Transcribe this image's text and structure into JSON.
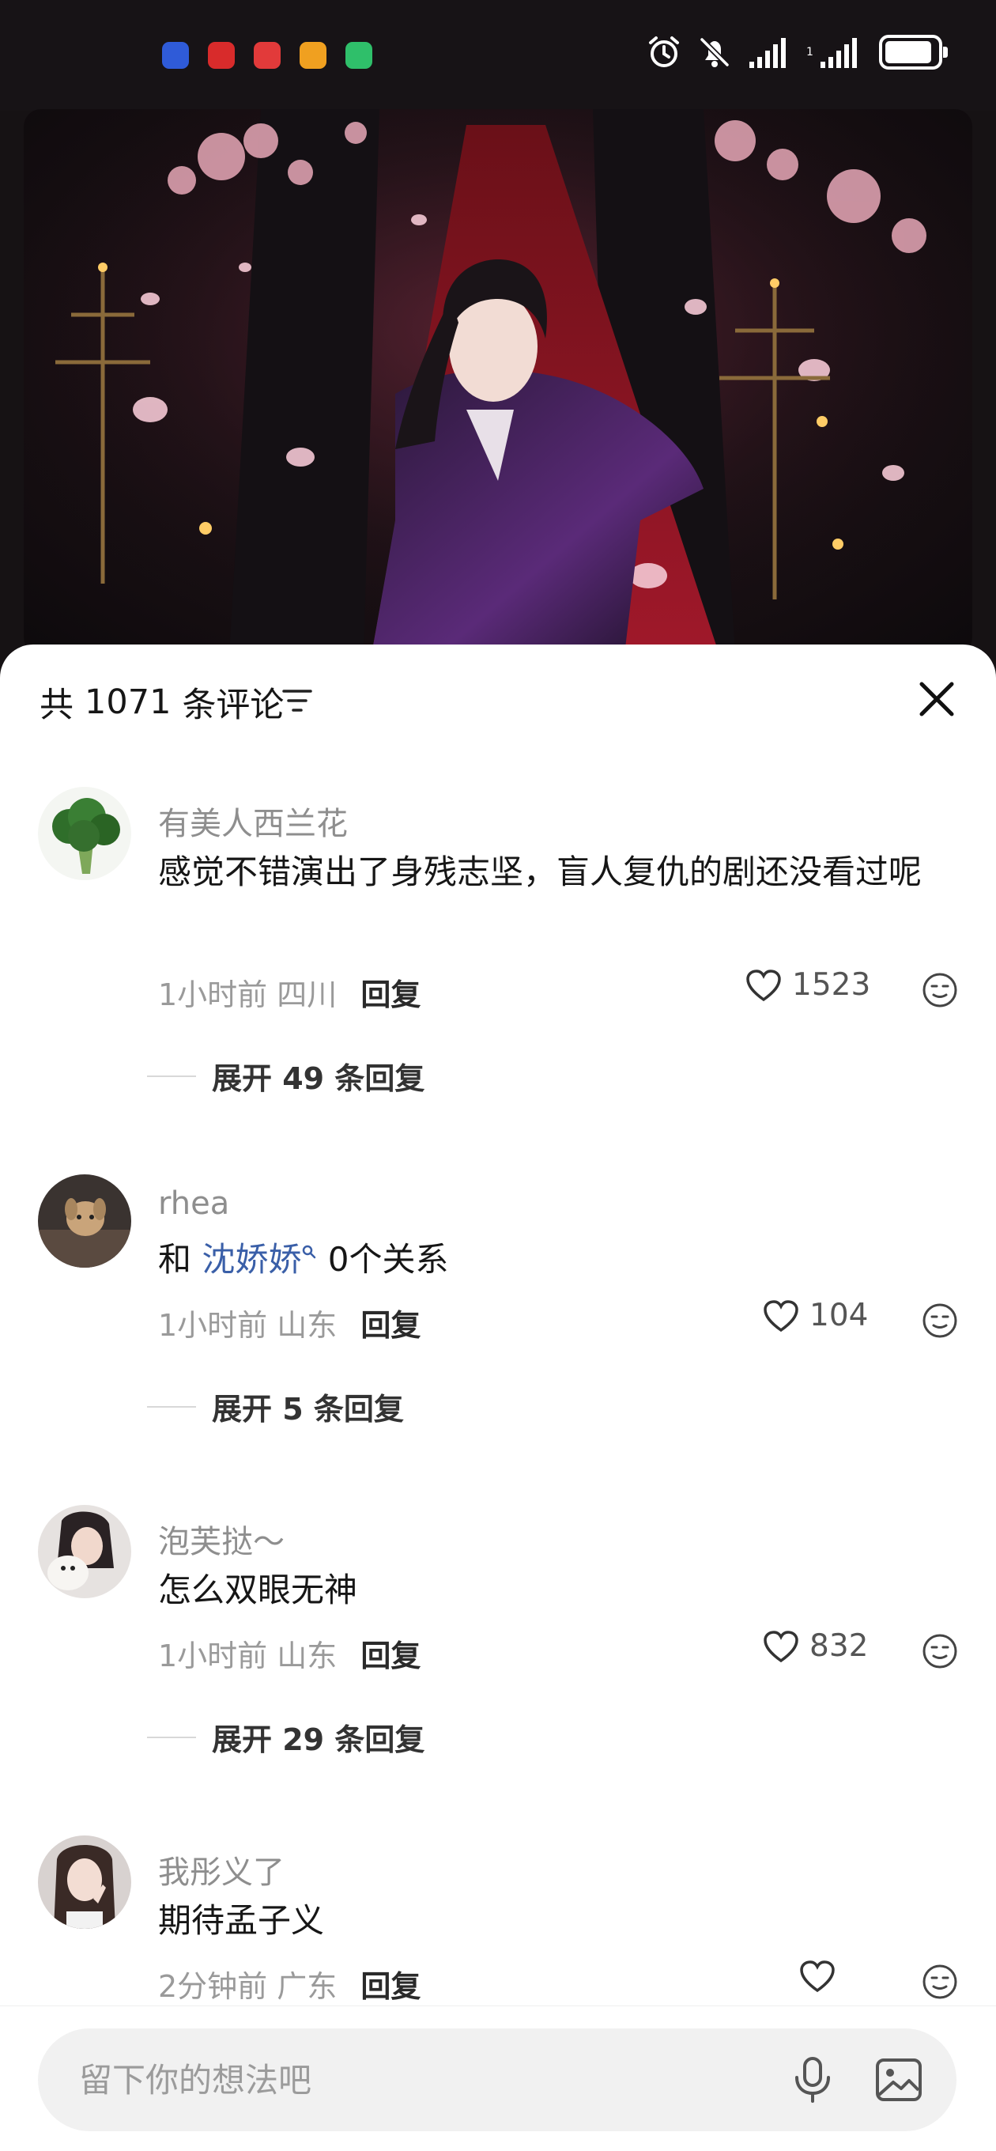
{
  "status_bar": {
    "notification_colors": [
      "#2f5bd8",
      "#d82b2b",
      "#e23a3a",
      "#f0a020",
      "#2fbf6a"
    ],
    "icons": [
      "alarm-icon",
      "mute-icon",
      "signal-icon",
      "signal-4g-icon",
      "battery-icon"
    ],
    "battery_level": 0.9
  },
  "header": {
    "prefix": "共",
    "count": "1071",
    "suffix": "条评论",
    "filter_icon": "filter-icon",
    "close_icon": "close-icon"
  },
  "comments": [
    {
      "user": "有美人西兰花",
      "text": "感觉不错演出了身残志坚，盲人复仇的剧还没看过呢",
      "time": "1小时前",
      "location": "四川",
      "reply_label": "回复",
      "likes": "1523",
      "expand": "展开 49 条回复"
    },
    {
      "user": "rhea",
      "text_prefix": "和 ",
      "mention": "沈娇娇",
      "text_suffix": " 0个关系",
      "time": "1小时前",
      "location": "山东",
      "reply_label": "回复",
      "likes": "104",
      "expand": "展开 5 条回复"
    },
    {
      "user": "泡芙挞～",
      "text": "怎么双眼无神",
      "time": "1小时前",
      "location": "山东",
      "reply_label": "回复",
      "likes": "832",
      "expand": "展开 29 条回复"
    },
    {
      "user": "我彤义了",
      "text": "期待孟子义",
      "time": "2分钟前",
      "location": "广东",
      "reply_label": "回复",
      "likes": ""
    }
  ],
  "input": {
    "placeholder": "留下你的想法吧",
    "mic_icon": "microphone-icon",
    "image_icon": "image-icon"
  },
  "colors": {
    "mention": "#3a5fa8",
    "text": "#161616",
    "meta": "#9a9a9a"
  }
}
